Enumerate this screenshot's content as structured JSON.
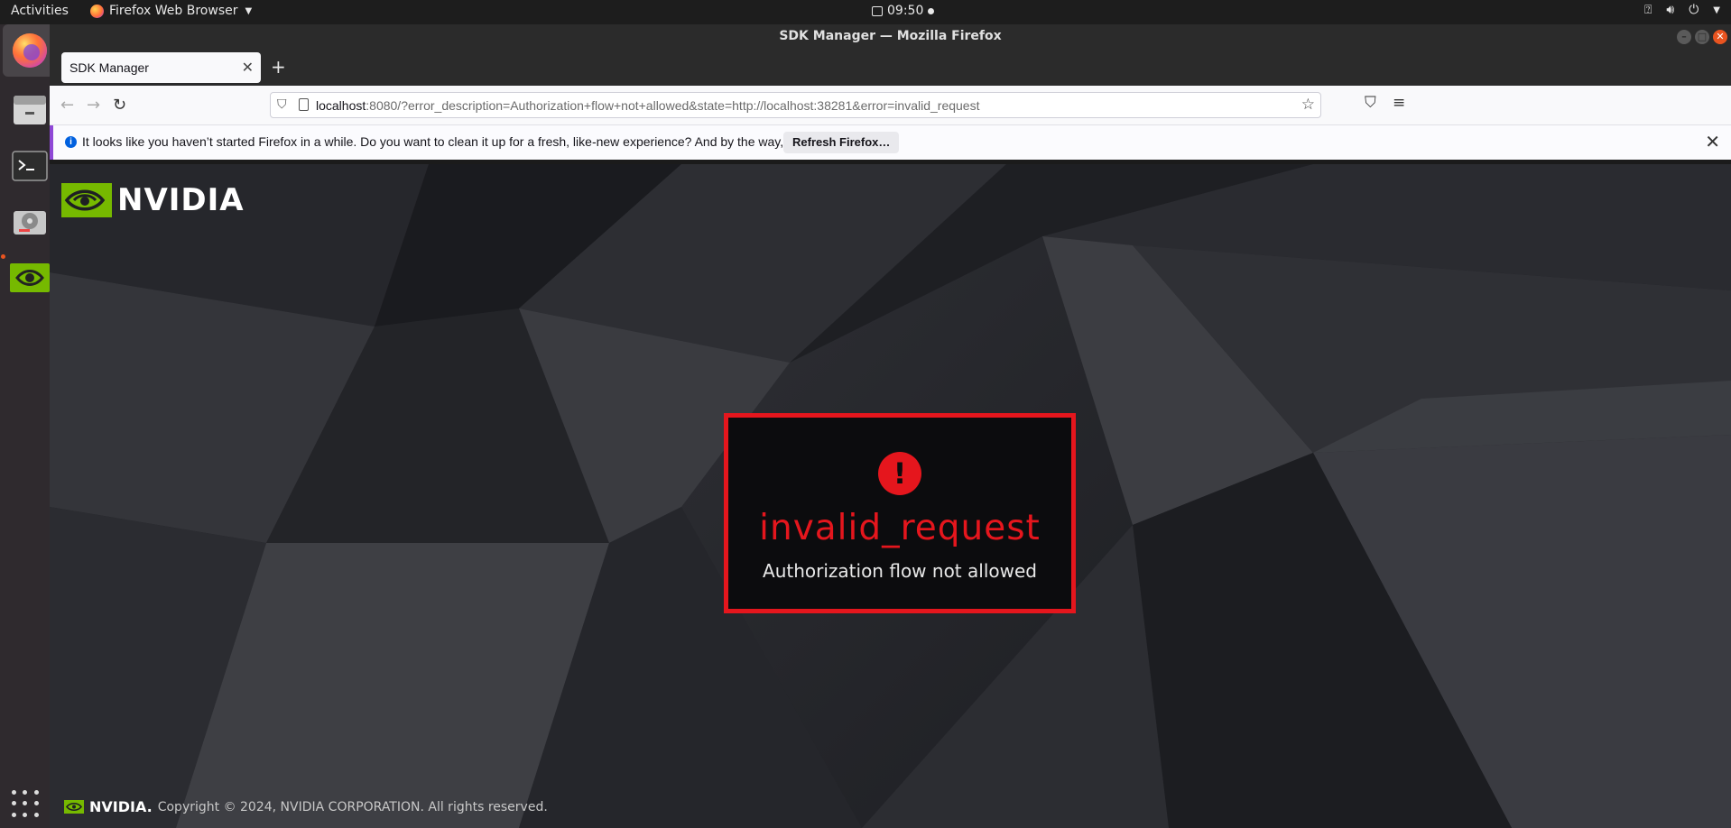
{
  "topbar": {
    "activities": "Activities",
    "app_menu": "Firefox Web Browser",
    "clock": "09:50"
  },
  "dock": {
    "items": [
      "Firefox",
      "Files",
      "Terminal",
      "Disks",
      "NVIDIA SDK Manager"
    ]
  },
  "window": {
    "title": "SDK Manager — Mozilla Firefox"
  },
  "tabs": [
    {
      "title": "SDK Manager"
    }
  ],
  "urlbar": {
    "host": "localhost",
    "rest": ":8080/?error_description=Authorization+flow+not+allowed&state=http://localhost:38281&error=invalid_request"
  },
  "notification": {
    "message": "It looks like you haven’t started Firefox in a while. Do you want to clean it up for a fresh, like-new experience? And by the way, welcome back!",
    "button": "Refresh Firefox…"
  },
  "page": {
    "brand": "NVIDIA",
    "error_code": "invalid_request",
    "error_description": "Authorization flow not allowed",
    "footer_brand": "NVIDIA.",
    "footer_text": "Copyright © 2024, NVIDIA CORPORATION. All rights reserved."
  },
  "colors": {
    "nvidia_green": "#76b900",
    "error_red": "#e5161d"
  }
}
